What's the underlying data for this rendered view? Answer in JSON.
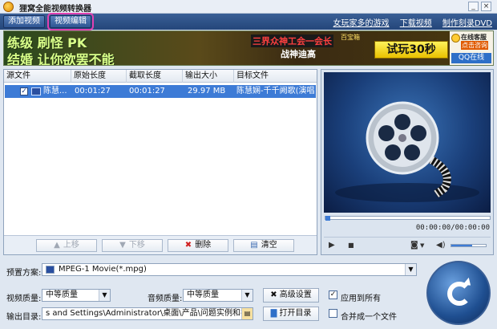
{
  "window": {
    "title": "狸窝全能视频转换器"
  },
  "toolbar": {
    "add_video": "添加视频",
    "edit_video": "视频编辑",
    "links": [
      "女玩家多的游戏",
      "下载视频",
      "制作刻录DVD"
    ]
  },
  "banner": {
    "slogan1": "练级 刷怪 PK",
    "slogan2": "结婚 让你欲罢不能",
    "guild_text": "三界众神工会一会长",
    "war_text": "战神迪高",
    "shop_text": "百宝箱",
    "try_button": "试玩30秒",
    "service_online": "在线客服",
    "service_click": "点击咨询",
    "qq_online": "QQ在线"
  },
  "table": {
    "headers": [
      "源文件",
      "原始长度",
      "截取长度",
      "输出大小",
      "目标文件"
    ],
    "rows": [
      {
        "checked": true,
        "source": "陈慧...",
        "original": "00:01:27",
        "cut": "00:01:27",
        "size": "29.97 MB",
        "target": "陈慧娴-千千阙歌(演唱..."
      }
    ]
  },
  "actions": {
    "up": "上移",
    "down": "下移",
    "delete": "删除",
    "clear": "清空"
  },
  "preview": {
    "timecode": "00:00:00/00:00:00",
    "volume_level": 0.6,
    "seek_position": 0
  },
  "settings": {
    "preset_label": "预置方案:",
    "preset_value": "MPEG-1 Movie(*.mpg)",
    "video_quality_label": "视频质量:",
    "video_quality": "中等质量",
    "audio_quality_label": "音频质量:",
    "audio_quality": "中等质量",
    "advanced_button": "高级设置",
    "apply_all_label": "应用到所有",
    "apply_all_checked": true,
    "output_label": "输出目录:",
    "output_path": "s and Settings\\Administrator\\桌面\\产品\\问题实例和视频原件\\转换",
    "open_dir_button": "打开目录",
    "merge_label": "合并成一个文件",
    "merge_checked": false
  },
  "colors": {
    "toolbar": "#2e5592",
    "selection": "#3d7bd6",
    "accent": "#e040b0"
  }
}
